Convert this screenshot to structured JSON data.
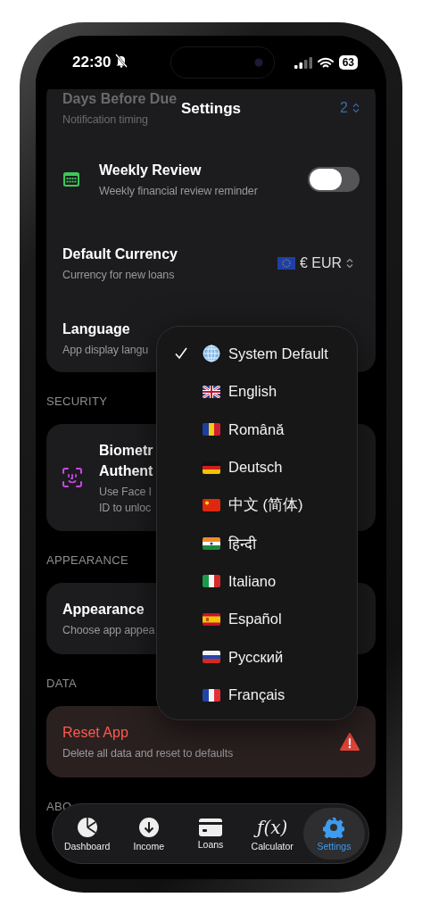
{
  "status_bar": {
    "time": "22:30",
    "battery": "63"
  },
  "header": {
    "title": "Settings"
  },
  "groups": [
    {
      "rows": [
        {
          "kind": "stepper",
          "title": "Days Before Due",
          "subtitle": "Notification timing",
          "value": "2",
          "dim": true
        },
        {
          "kind": "toggle",
          "title": "Weekly Review",
          "subtitle": "Weekly financial review reminder",
          "on": false
        },
        {
          "kind": "picker",
          "title": "Default Currency",
          "subtitle": "Currency for new loans",
          "value": "€ EUR"
        },
        {
          "kind": "text",
          "title": "Language",
          "subtitle": "App display langu"
        }
      ]
    },
    {
      "label": "SECURITY",
      "rows": [
        {
          "kind": "text",
          "title": "Biometr\nAuthent",
          "subtitle": "Use Face I\nID to unloc"
        }
      ]
    },
    {
      "label": "APPEARANCE",
      "rows": [
        {
          "kind": "text",
          "title": "Appearance",
          "subtitle": "Choose app appea"
        }
      ]
    },
    {
      "label": "DATA",
      "rows": [
        {
          "kind": "danger",
          "title": "Reset App",
          "subtitle": "Delete all data and reset to defaults"
        }
      ]
    },
    {
      "label": "ABO"
    }
  ],
  "language_menu": [
    {
      "label": "System Default",
      "selected": true
    },
    {
      "label": "English",
      "selected": false
    },
    {
      "label": "Română",
      "selected": false
    },
    {
      "label": "Deutsch",
      "selected": false
    },
    {
      "label": "中文 (简体)",
      "selected": false
    },
    {
      "label": "हिन्दी",
      "selected": false
    },
    {
      "label": "Italiano",
      "selected": false
    },
    {
      "label": "Español",
      "selected": false
    },
    {
      "label": "Русский",
      "selected": false
    },
    {
      "label": "Français",
      "selected": false
    }
  ],
  "tab_bar": [
    {
      "label": "Dashboard",
      "selected": false
    },
    {
      "label": "Income",
      "selected": false
    },
    {
      "label": "Loans",
      "selected": false
    },
    {
      "label": "Calculator",
      "glyph": "ƒ(x)",
      "selected": false
    },
    {
      "label": "Settings",
      "selected": true
    }
  ]
}
